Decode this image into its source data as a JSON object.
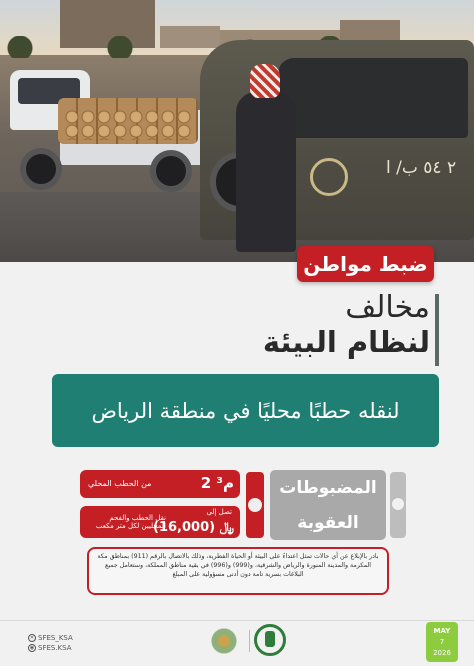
{
  "headline": {
    "badge": "ضبط مواطن",
    "line1": "مخالف",
    "line2": "لنظام البيئة"
  },
  "reason": "لنقله حطبًا محليًا في منطقة الرياض",
  "stats": {
    "seized_label": "المضبوطات",
    "seized_value": "2 م³",
    "seized_desc": "من الحطب المحلي",
    "penalty_label": "العقوبة",
    "penalty_value": "(16,000) ﷼",
    "penalty_prefix": "تصل إلى",
    "penalty_desc": "نقل الحطب والفحم المحليين لكل متر مكعب"
  },
  "notice": "بادر بالإبلاغ عن أي حالات تمثل اعتداءً على البيئة أو الحياة الفطرية، وذلك بالاتصال بالرقم (911) بمناطق مكة المكرمة والمدينة المنورة والرياض والشرقية، و(999) و(996) في بقية مناطق المملكة، وستعامل جميع البلاغات بسرية تامة دون أدنى مسؤولية على المبلغ",
  "photo": {
    "plate_text": "٢ ٥٤ ب/ ا"
  },
  "footer": {
    "handle1": "SFES_KSA",
    "handle2": "SFES.KSA",
    "date_month": "MAY",
    "date_day": "7",
    "date_year": "2026"
  },
  "colors": {
    "red": "#c51f26",
    "teal": "#1f7f72",
    "grey": "#a9a9a9",
    "green": "#8ccc3e"
  }
}
